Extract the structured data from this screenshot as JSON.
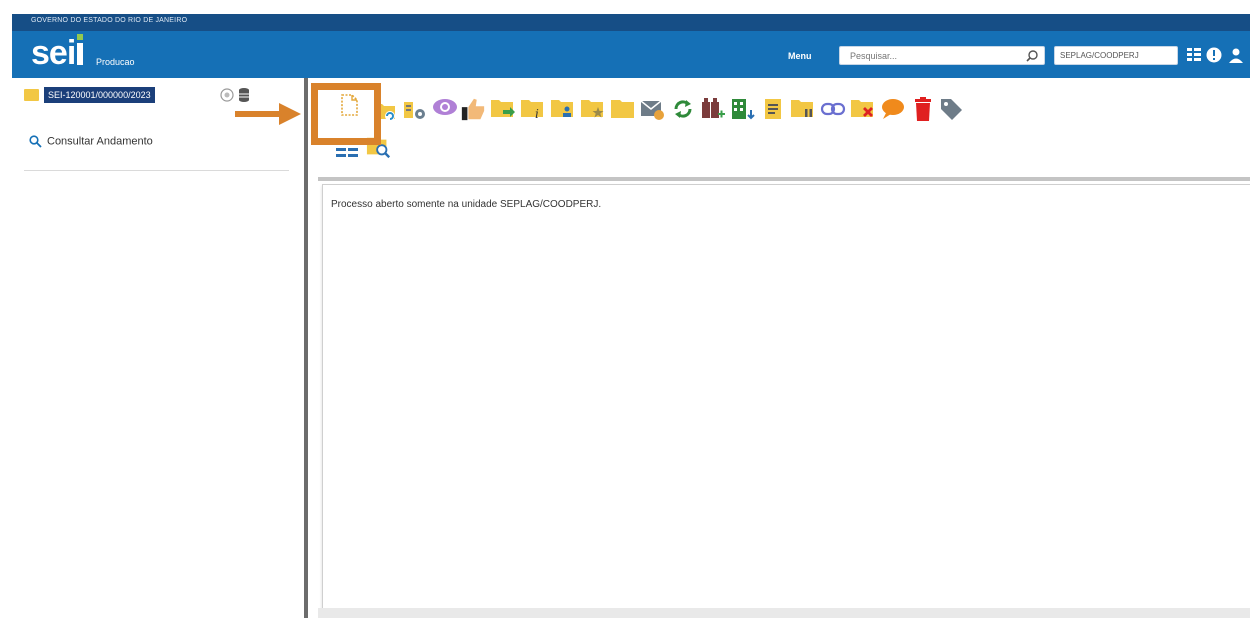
{
  "header": {
    "government": "GOVERNO DO ESTADO DO RIO DE JANEIRO",
    "logo": "sei",
    "environment": "Producao",
    "menu_label": "Menu",
    "search_placeholder": "Pesquisar...",
    "unit": "SEPLAG/COODPERJ",
    "icons": [
      "list-icon",
      "info-icon",
      "user-icon"
    ]
  },
  "sidebar": {
    "process_number": "SEI-120001/000000/2023",
    "consult_label": "Consultar Andamento"
  },
  "toolbar": {
    "row1_icons": [
      "new-document-icon",
      "relate-process-icon",
      "process-settings-icon",
      "view-eye-icon",
      "thumbs-up-icon",
      "send-process-icon",
      "update-process-icon",
      "assign-user-icon",
      "favorite-process-icon",
      "folder-icon",
      "send-email-icon",
      "refresh-icon",
      "add-process-icon",
      "building-icon",
      "note-icon",
      "suspend-process-icon",
      "link-icon",
      "close-process-icon",
      "comment-icon",
      "delete-icon",
      "tag-icon"
    ],
    "row2_icons": [
      "list-view-icon",
      "search-folder-icon"
    ],
    "highlighted": "new-document-icon"
  },
  "content": {
    "message": "Processo aberto somente na unidade SEPLAG/COODPERJ."
  },
  "colors": {
    "gov_bar": "#164e86",
    "header": "#1570b6",
    "highlight": "#d9822b",
    "folder": "#f2c744"
  }
}
